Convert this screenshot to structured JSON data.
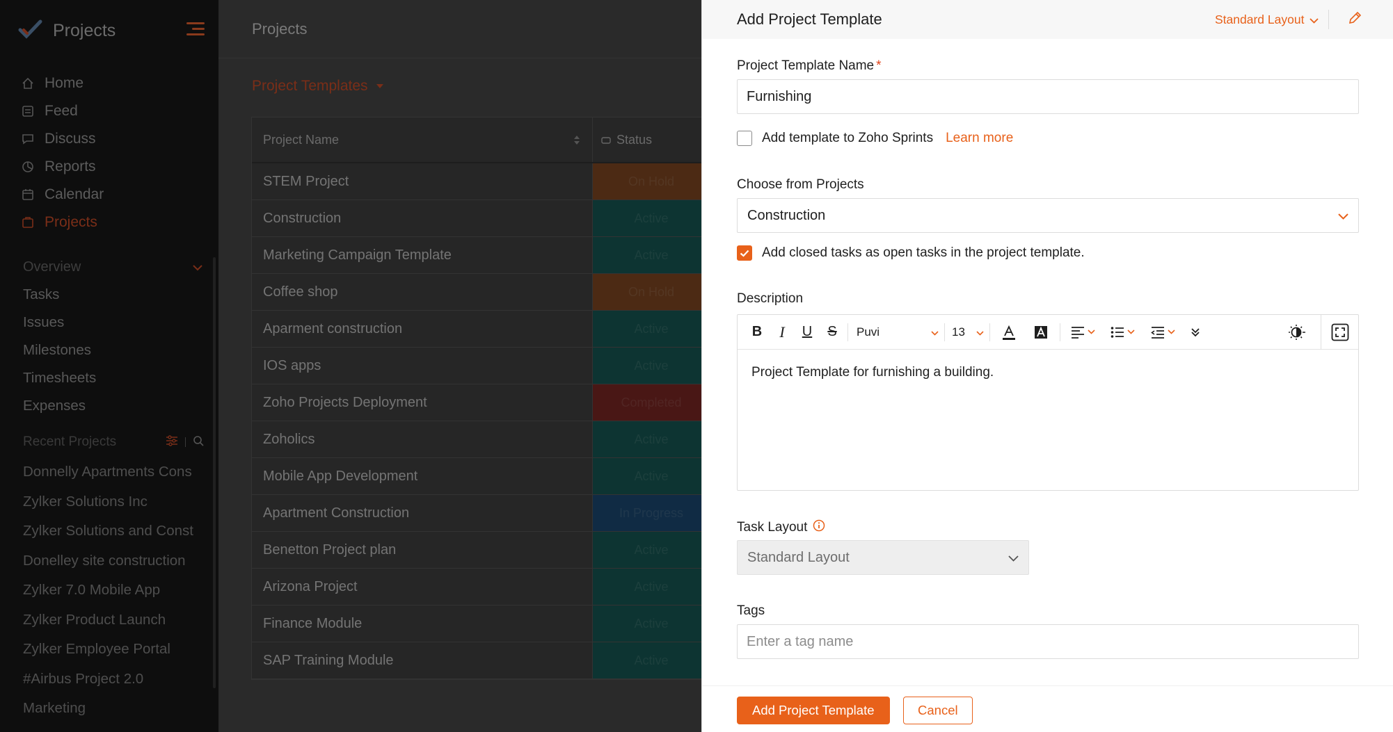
{
  "sidebar": {
    "brand": "Projects",
    "nav": [
      {
        "label": "Home",
        "icon": "home-icon"
      },
      {
        "label": "Feed",
        "icon": "feed-icon"
      },
      {
        "label": "Discuss",
        "icon": "discuss-icon"
      },
      {
        "label": "Reports",
        "icon": "reports-icon"
      },
      {
        "label": "Calendar",
        "icon": "calendar-icon"
      },
      {
        "label": "Projects",
        "icon": "projects-icon",
        "active": true
      }
    ],
    "overview_label": "Overview",
    "sub_items": [
      "Tasks",
      "Issues",
      "Milestones",
      "Timesheets",
      "Expenses"
    ],
    "recent_label": "Recent Projects",
    "recent": [
      "Donnelly Apartments Cons",
      "Zylker Solutions Inc",
      "Zylker Solutions and Const",
      "Donelley site construction",
      "Zylker 7.0 Mobile App",
      "Zylker Product Launch",
      "Zylker Employee Portal",
      "#Airbus Project 2.0",
      "Marketing"
    ]
  },
  "main": {
    "title": "Projects",
    "view_label": "Project Templates",
    "columns": {
      "name": "Project Name",
      "status": "Status"
    },
    "rows": [
      {
        "name": "STEM Project",
        "status": "On Hold",
        "color": "#8a4d24"
      },
      {
        "name": "Construction",
        "status": "Active",
        "color": "#175f5a"
      },
      {
        "name": "Marketing Campaign Template",
        "status": "Active",
        "color": "#175f5a"
      },
      {
        "name": "Coffee shop",
        "status": "On Hold",
        "color": "#8a4d24"
      },
      {
        "name": "Aparment construction",
        "status": "Active",
        "color": "#175f5a"
      },
      {
        "name": "IOS apps",
        "status": "Active",
        "color": "#175f5a"
      },
      {
        "name": "Zoho Projects Deployment",
        "status": "Completed",
        "color": "#852a26"
      },
      {
        "name": "Zoholics",
        "status": "Active",
        "color": "#175f5a"
      },
      {
        "name": "Mobile App Development",
        "status": "Active",
        "color": "#175f5a"
      },
      {
        "name": "Apartment Construction",
        "status": "In Progress",
        "color": "#1d4f7c"
      },
      {
        "name": "Benetton Project plan",
        "status": "Active",
        "color": "#175f5a"
      },
      {
        "name": "Arizona Project",
        "status": "Active",
        "color": "#175f5a"
      },
      {
        "name": "Finance Module",
        "status": "Active",
        "color": "#175f5a"
      },
      {
        "name": "SAP Training Module",
        "status": "Active",
        "color": "#175f5a"
      }
    ]
  },
  "panel": {
    "title": "Add Project Template",
    "layout_switch": "Standard Layout",
    "name_label": "Project Template Name",
    "name_value": "Furnishing",
    "sprints_label": "Add template to Zoho Sprints",
    "learn_more": "Learn more",
    "choose_label": "Choose from Projects",
    "choose_value": "Construction",
    "closed_tasks_label": "Add closed tasks as open tasks in the project template.",
    "description_label": "Description",
    "editor": {
      "font": "Puvi",
      "size": "13",
      "content": "Project Template for furnishing a building."
    },
    "task_layout_label": "Task Layout",
    "task_layout_value": "Standard Layout",
    "tags_label": "Tags",
    "tags_placeholder": "Enter a tag name",
    "add_button": "Add Project Template",
    "cancel_button": "Cancel"
  },
  "colors": {
    "accent": "#e8611a",
    "active_status": "#175f5a",
    "on_hold_status": "#8a4d24",
    "completed_status": "#852a26",
    "in_progress_status": "#1d4f7c"
  }
}
